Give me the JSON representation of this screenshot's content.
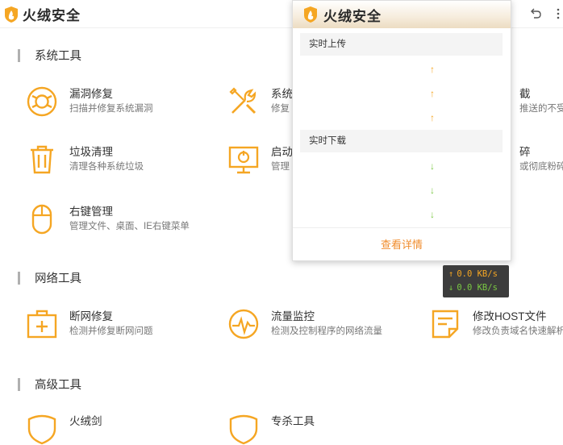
{
  "app": {
    "title": "火绒安全"
  },
  "sections": [
    {
      "title": "系统工具"
    },
    {
      "title": "网络工具"
    },
    {
      "title": "高级工具"
    }
  ],
  "tools": [
    {
      "name": "漏洞修复",
      "desc": "扫描并修复系统漏洞",
      "icon": "lifebuoy-icon"
    },
    {
      "name": "系统",
      "desc": "修复",
      "icon": "wrench-screwdriver-icon"
    },
    {
      "name": "截",
      "desc": "推送的不受",
      "icon": "popup-block-icon"
    },
    {
      "name": "垃圾清理",
      "desc": "清理各种系统垃圾",
      "icon": "trash-icon"
    },
    {
      "name": "启动",
      "desc": "管理",
      "icon": "monitor-power-icon"
    },
    {
      "name": "碎",
      "desc": "或彻底粉碎",
      "icon": "shredder-icon"
    },
    {
      "name": "右键管理",
      "desc": "管理文件、桌面、IE右键菜单",
      "icon": "mouse-icon"
    },
    {
      "name": "断网修复",
      "desc": "检测并修复断网问题",
      "icon": "first-aid-kit-icon"
    },
    {
      "name": "流量监控",
      "desc": "检测及控制程序的网络流量",
      "icon": "speedometer-icon"
    },
    {
      "name": "修改HOST文件",
      "desc": "修改负责域名快速解析",
      "icon": "document-edit-icon"
    },
    {
      "name": "火绒剑",
      "icon": "shield-icon"
    },
    {
      "name": "专杀工具",
      "icon": "shield-tool-icon"
    }
  ],
  "popup": {
    "title": "火绒安全",
    "upload_label": "实时上传",
    "download_label": "实时下载",
    "up_arrow": "↑",
    "down_arrow": "↓",
    "details_label": "查看详情"
  },
  "speed": {
    "up_arrow": "↑",
    "down_arrow": "↓",
    "upload": "0.0 KB/s",
    "download": "0.0 KB/s"
  },
  "colors": {
    "accent": "#f5a623",
    "upload": "#f5a623",
    "download": "#7ac943",
    "link": "#f08c2c"
  }
}
